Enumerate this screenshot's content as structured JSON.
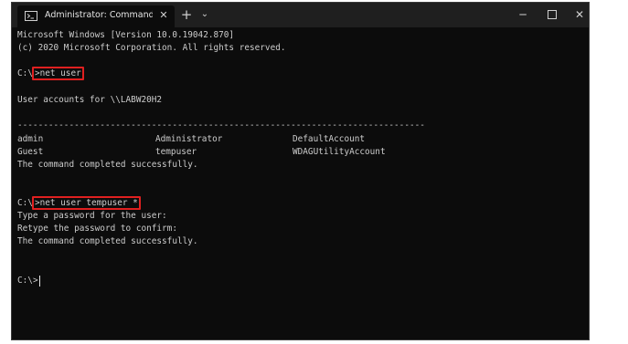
{
  "window": {
    "tab_title": "Administrator: Command Prompt",
    "tab_close_glyph": "✕",
    "new_tab_glyph": "+",
    "dropdown_glyph": "⌄",
    "minimize_glyph": "─",
    "close_glyph": "✕",
    "background_color": "#0c0c0c",
    "titlebar_color": "#1f1f1f",
    "text_color": "#cccccc",
    "highlight_color": "#e02020"
  },
  "console": {
    "version_line": "Microsoft Windows [Version 10.0.19042.870]",
    "copyright_line": "(c) 2020 Microsoft Corporation. All rights reserved.",
    "prompt1": "C:\\",
    "cmd1": ">net user",
    "accounts_header": "User accounts for \\\\LABW20H2",
    "separator": "-------------------------------------------------------------------------------",
    "accounts": [
      [
        "admin",
        "Administrator",
        "DefaultAccount"
      ],
      [
        "Guest",
        "tempuser",
        "WDAGUtilityAccount"
      ]
    ],
    "success1": "The command completed successfully.",
    "prompt2": "C:\\",
    "cmd2": ">net user tempuser *",
    "password_prompt": "Type a password for the user:",
    "retype_prompt": "Retype the password to confirm:",
    "success2": "The command completed successfully.",
    "prompt3": "C:\\",
    "cmd3": ">"
  }
}
